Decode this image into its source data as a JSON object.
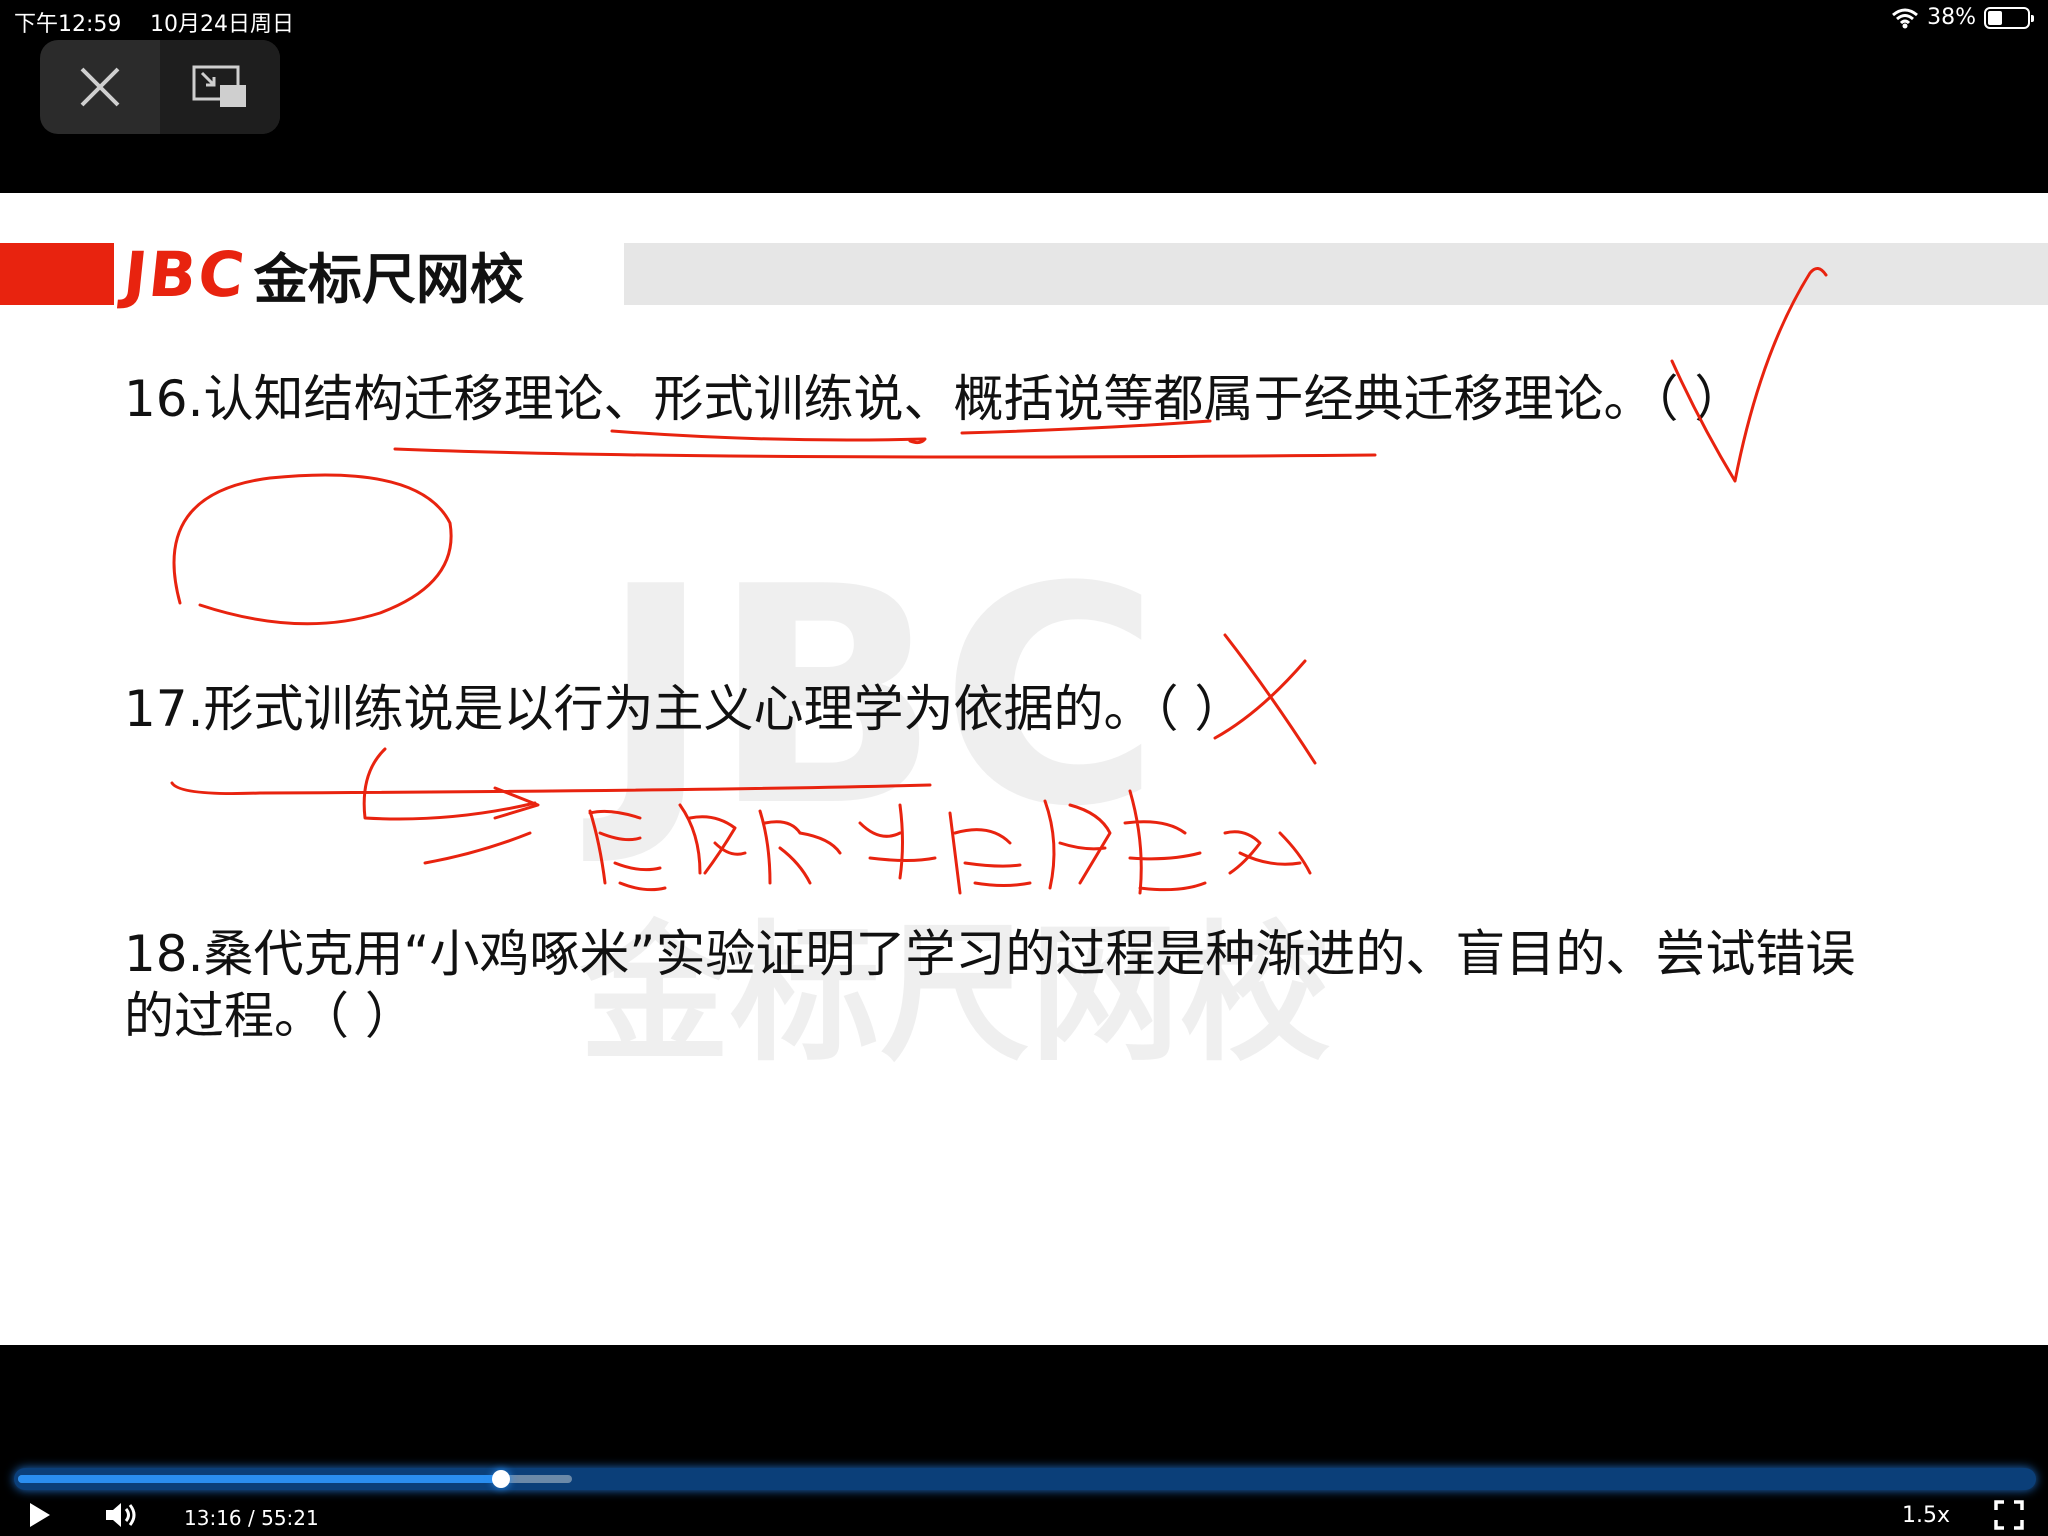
{
  "status_bar": {
    "time": "下午12:59",
    "date": "10月24日周日",
    "battery_text": "38%",
    "battery_level": 0.38
  },
  "top_controls": {
    "close_icon": "close-icon",
    "pip_icon": "picture-in-picture-icon"
  },
  "slide": {
    "logo": {
      "brand": "JBC",
      "name": "金标尺网校"
    },
    "watermark": {
      "brand": "JBC",
      "name": "金标尺网校"
    },
    "questions": [
      {
        "text": "16.认知结构迁移理论、形式训练说、概括说等都属于经典迁移理论。（ ）"
      },
      {
        "text": "17.形式训练说是以行为主义心理学为依据的。（ ）"
      },
      {
        "text": "18.桑代克用“小鸡啄米”实验证明了学习的过程是种渐进的、盲目的、尝试错误的过程。（ ）"
      }
    ],
    "annotation_color": "#e8230f"
  },
  "player": {
    "timecode": "13:16 / 55:21",
    "speed": "1.5x",
    "progress_fraction": 0.24,
    "buffered_fraction": 0.275,
    "accent_color": "#2a8ef0"
  }
}
